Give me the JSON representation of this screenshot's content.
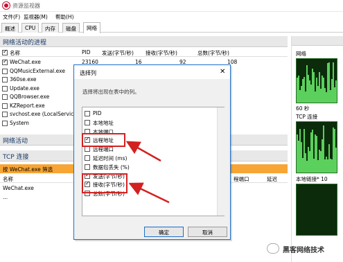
{
  "window": {
    "title": "资源监视器"
  },
  "menu": [
    "文件(F)",
    "监视器(M)",
    "帮助(H)"
  ],
  "tabs": [
    "概述",
    "CPU",
    "内存",
    "磁盘",
    "网络"
  ],
  "sections": {
    "net_processes": "网络活动的进程",
    "net_activity": "网络活动",
    "tcp": "TCP 连接"
  },
  "proc_table": {
    "headers": [
      "名称",
      "PID",
      "发送(字节/秒)",
      "接收(字节/秒)",
      "总数(字节/秒)"
    ],
    "rows": [
      {
        "name": "WeChat.exe",
        "pid": "23160",
        "send": "16",
        "recv": "92",
        "total": "108",
        "checked": true
      },
      {
        "name": "QQMusicExternal.exe",
        "pid": "",
        "send": "",
        "recv": "",
        "total": "",
        "checked": false
      },
      {
        "name": "360se.exe",
        "pid": "",
        "send": "",
        "recv": "",
        "total": "",
        "checked": false
      },
      {
        "name": "Update.exe",
        "pid": "",
        "send": "",
        "recv": "",
        "total": "",
        "checked": false
      },
      {
        "name": "QQBrowser.exe",
        "pid": "",
        "send": "",
        "recv": "",
        "total": "",
        "checked": false
      },
      {
        "name": "KZReport.exe",
        "pid": "",
        "send": "",
        "recv": "",
        "total": "",
        "checked": false
      },
      {
        "name": "svchost.exe (LocalServiceA...",
        "pid": "",
        "send": "",
        "recv": "",
        "total": "",
        "checked": false
      },
      {
        "name": "System",
        "pid": "",
        "send": "",
        "recv": "",
        "total": "",
        "checked": false
      }
    ]
  },
  "tcp_filter": "按 WeChat.exe 筛选",
  "tcp_table": {
    "headers": [
      "名称",
      "程端口",
      "延迟"
    ],
    "rows": [
      {
        "name": "WeChat.exe"
      },
      {
        "name": "..."
      }
    ]
  },
  "right_panel": {
    "labels": [
      "网络",
      "60 秒",
      "TCP 连接",
      "本地链接* 10"
    ]
  },
  "dialog": {
    "title": "选择列",
    "close": "✕",
    "description": "选择将出现在表中的列。",
    "items": [
      {
        "label": "PID",
        "checked": false
      },
      {
        "label": "本地地址",
        "checked": false
      },
      {
        "label": "本地端口",
        "checked": false
      },
      {
        "label": "远程地址",
        "checked": true
      },
      {
        "label": "远程端口",
        "checked": false
      },
      {
        "label": "延迟时间 (ms)",
        "checked": false
      },
      {
        "label": "数据包丢失 (%)",
        "checked": false
      },
      {
        "label": "发送(字节/秒)",
        "checked": true
      },
      {
        "label": "接收(字节/秒)",
        "checked": true
      },
      {
        "label": "总数(字节/秒)",
        "checked": false
      }
    ],
    "ok": "确定",
    "cancel": "取消"
  },
  "watermark": "黑客网络技术",
  "colors": {
    "accent": "#1a6ec9",
    "highlight": "#d32020",
    "filter_bar": "#f7a535",
    "graph_bg": "#0b2b0b",
    "graph_fg": "#5cd05c"
  }
}
